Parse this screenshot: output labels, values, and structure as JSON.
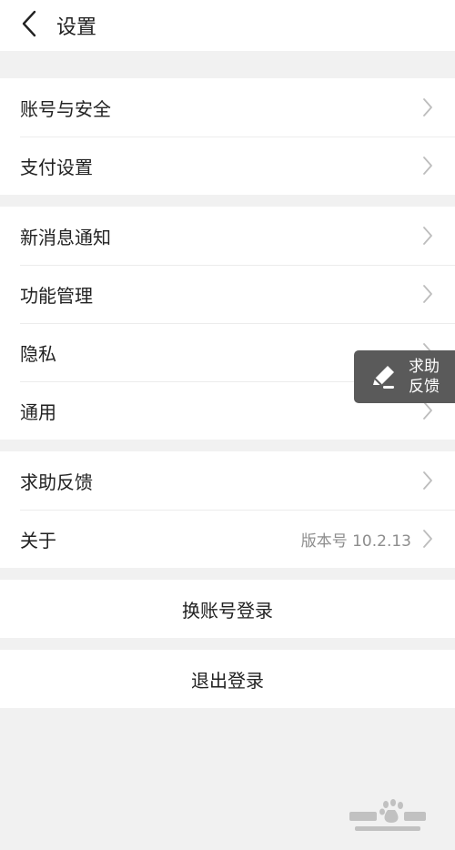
{
  "header": {
    "title": "设置",
    "back_icon": "chevron-left-icon"
  },
  "groups": [
    {
      "items": [
        {
          "label": "账号与安全",
          "icon": "chevron-right-icon"
        },
        {
          "label": "支付设置",
          "icon": "chevron-right-icon"
        }
      ]
    },
    {
      "items": [
        {
          "label": "新消息通知",
          "icon": "chevron-right-icon"
        },
        {
          "label": "功能管理",
          "icon": "chevron-right-icon"
        },
        {
          "label": "隐私",
          "icon": "chevron-right-icon"
        },
        {
          "label": "通用",
          "icon": "chevron-right-icon"
        }
      ]
    },
    {
      "items": [
        {
          "label": "求助反馈",
          "icon": "chevron-right-icon"
        },
        {
          "label": "关于",
          "value": "版本号 10.2.13",
          "icon": "chevron-right-icon"
        }
      ]
    }
  ],
  "actions": {
    "switch_account": "换账号登录",
    "logout": "退出登录"
  },
  "floating_feedback": {
    "line1": "求助",
    "line2": "反馈",
    "icon": "edit-pencil-icon"
  },
  "watermark": {
    "icon": "baidu-jingyan-logo"
  },
  "colors": {
    "background": "#f1f1f1",
    "surface": "#ffffff",
    "text_primary": "#222222",
    "text_secondary": "#8d8d8d",
    "chevron": "#bdbdbd",
    "float_bg": "#5a5a5a"
  }
}
